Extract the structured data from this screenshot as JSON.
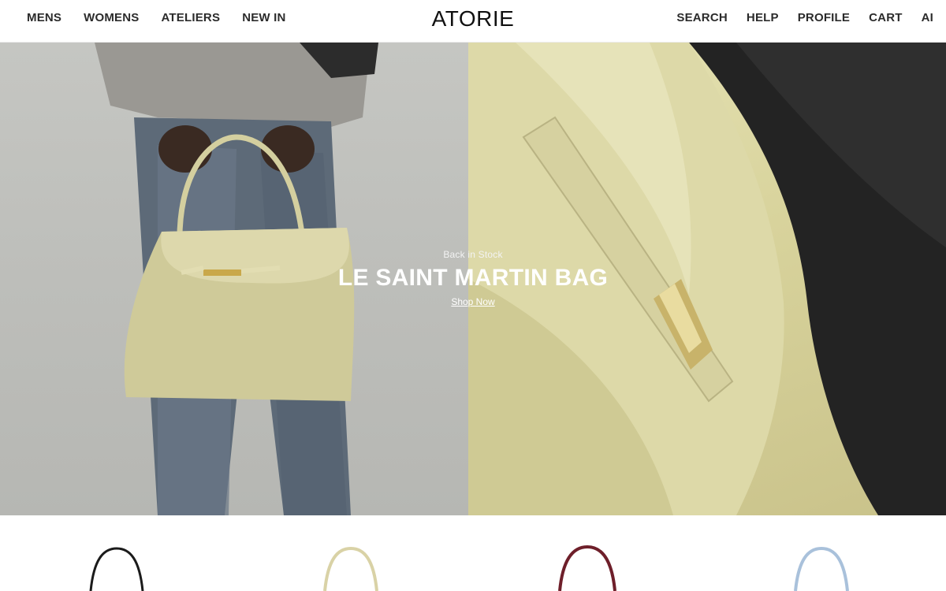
{
  "header": {
    "logo": "ATORIE",
    "nav_left": [
      "MENS",
      "WOMENS",
      "ATELIERS",
      "NEW IN"
    ],
    "nav_right": [
      "SEARCH",
      "HELP",
      "PROFILE",
      "CART",
      "AI"
    ]
  },
  "hero": {
    "eyebrow": "Back in Stock",
    "title": "LE SAINT MARTIN BAG",
    "cta": "Shop Now"
  },
  "products": {
    "handle_colors": [
      "#1b1b1b",
      "#d9d2a6",
      "#6e1f2a",
      "#a9c1db"
    ]
  },
  "colors": {
    "left_backdrop": "#c1c2be",
    "bag_cream": "#d9d4a4",
    "jacket_black": "#222222"
  }
}
